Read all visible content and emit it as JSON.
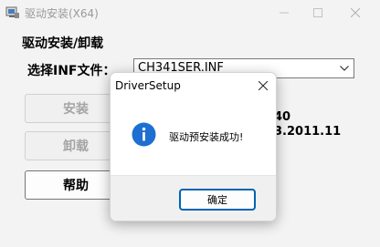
{
  "window": {
    "title": "驱动安装(X64)",
    "minimize_icon": "minimize-icon",
    "maximize_icon": "maximize-icon",
    "close_icon": "close-icon"
  },
  "main": {
    "group_title": "驱动安装/卸载",
    "inf_label": "选择INF文件：",
    "inf_selected": "CH341SER.INF",
    "buttons": {
      "install": "安装",
      "uninstall": "卸载",
      "help": "帮助"
    },
    "info_lines": [
      "40",
      "3.2011.11"
    ]
  },
  "dialog": {
    "title": "DriverSetup",
    "message": "驱动预安装成功!",
    "ok_label": "确定",
    "icon": "info-icon"
  },
  "colors": {
    "accent": "#0063b1",
    "info_icon": "#1d6fd1",
    "disabled_text": "#a5a5a5"
  }
}
